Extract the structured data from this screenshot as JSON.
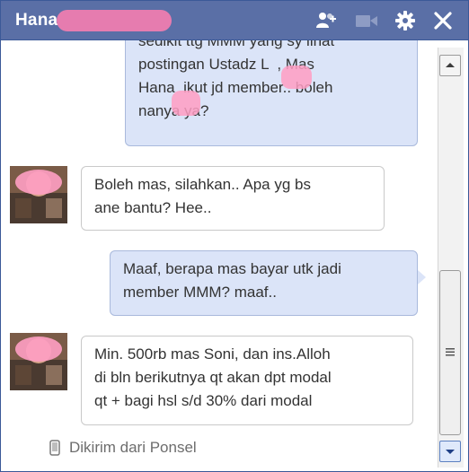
{
  "window": {
    "title": "Hana",
    "title_blur_color": "#ff7fb0",
    "header_color": "#5a6fa6",
    "icons": [
      "add-friend-icon",
      "video-call-icon",
      "settings-gear-icon",
      "close-icon"
    ]
  },
  "messages": [
    {
      "direction": "out",
      "text": "sedikit ttg MMM yang sy lihat\npostingan Ustadz L  , Mas\nHana  ikut jd member.. boleh\nnanya ya?"
    },
    {
      "direction": "in",
      "text": "Boleh mas, silahkan.. Apa yg bs\nane bantu? Hee.."
    },
    {
      "direction": "out",
      "text": "Maaf, berapa mas bayar utk jadi\nmember MMM? maaf.."
    },
    {
      "direction": "in",
      "text": "Min. 500rb mas Soni, dan ins.Alloh\ndi bln berikutnya qt akan dpt modal\nqt + bagi hsl s/d 30% dari modal"
    }
  ],
  "status": {
    "text": "Dikirim dari Ponsel",
    "icon": "mobile-phone-icon"
  },
  "scrollbar": {
    "up_icon": "scroll-up-arrow-icon",
    "down_icon": "scroll-down-arrow-icon",
    "grip_icon": "scroll-grip-icon"
  },
  "colors": {
    "outgoing_bubble": "#dbe4f8",
    "incoming_bubble": "#ffffff",
    "redaction": "#ff7fb0"
  }
}
